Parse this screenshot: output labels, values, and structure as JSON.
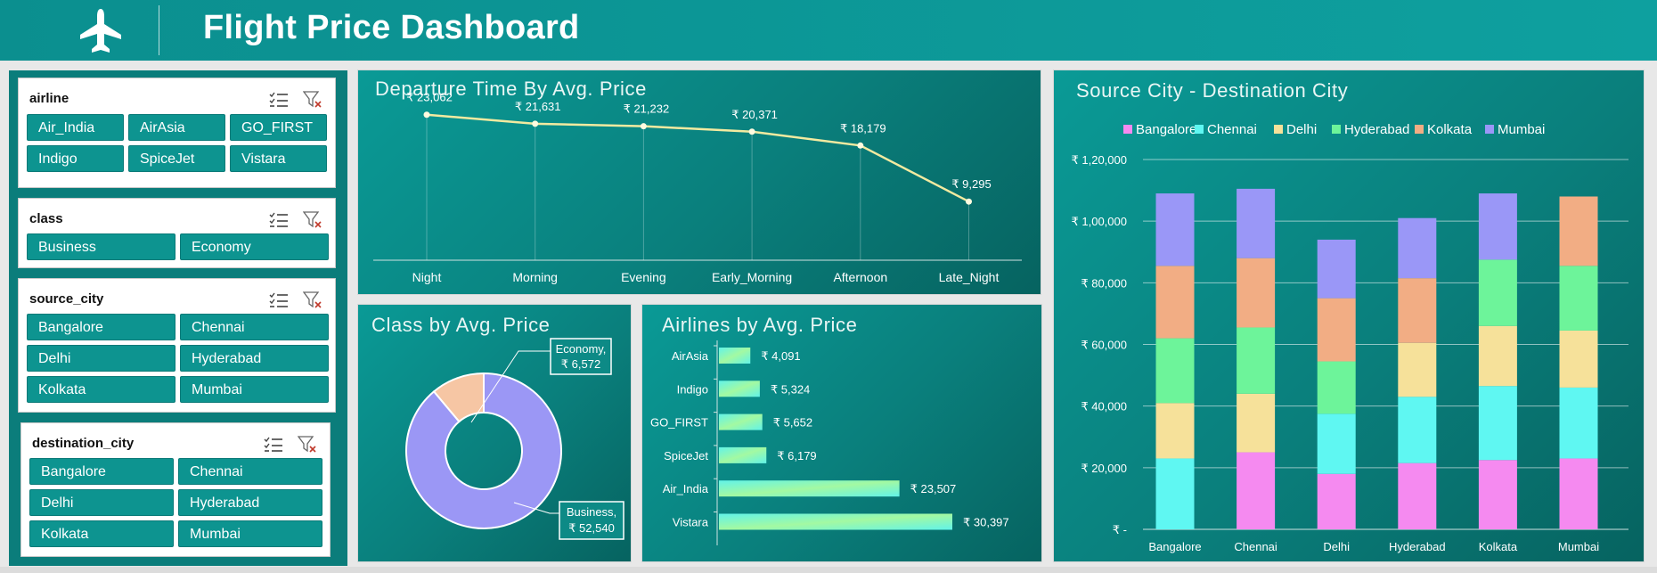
{
  "header": {
    "title": "Flight Price Dashboard",
    "icon": "airplane-icon"
  },
  "slicers": [
    {
      "key": "airline",
      "title": "airline",
      "items": [
        "Air_India",
        "AirAsia",
        "GO_FIRST",
        "Indigo",
        "SpiceJet",
        "Vistara"
      ]
    },
    {
      "key": "class",
      "title": "class",
      "items": [
        "Business",
        "Economy"
      ]
    },
    {
      "key": "source_city",
      "title": "source_city",
      "items": [
        "Bangalore",
        "Chennai",
        "Delhi",
        "Hyderabad",
        "Kolkata",
        "Mumbai"
      ]
    },
    {
      "key": "destination_city",
      "title": "destination_city",
      "items": [
        "Bangalore",
        "Chennai",
        "Delhi",
        "Hyderabad",
        "Kolkata",
        "Mumbai"
      ]
    }
  ],
  "slicer_icons": [
    "multi-select-icon",
    "clear-filter-icon"
  ],
  "panels": {
    "departure": {
      "title": "Departure Time By Avg. Price"
    },
    "class": {
      "title": "Class by Avg. Price"
    },
    "airlines": {
      "title": "Airlines by Avg. Price"
    },
    "city": {
      "title": "Source City - Destination City"
    }
  },
  "colors": {
    "header": "#0b8f8f",
    "line": "#f2eaa0",
    "economy": "#f6c6a4",
    "business": "#9b97f5",
    "bar_start": "#62f3e8",
    "bar_end": "#a3f9a2"
  },
  "chart_data": [
    {
      "id": "departure",
      "type": "line",
      "title": "Departure Time By Avg. Price",
      "categories": [
        "Night",
        "Morning",
        "Evening",
        "Early_Morning",
        "Afternoon",
        "Late_Night"
      ],
      "values": [
        23062,
        21631,
        21232,
        20371,
        18179,
        9295
      ],
      "labels": [
        "₹ 23,062",
        "₹ 21,631",
        "₹ 21,232",
        "₹ 20,371",
        "₹ 18,179",
        "₹ 9,295"
      ],
      "ylim": [
        0,
        25000
      ]
    },
    {
      "id": "class",
      "type": "pie",
      "title": "Class by Avg. Price",
      "slices": [
        {
          "name": "Economy",
          "value": 6572,
          "label_name": "Economy,",
          "label_value": "₹ 6,572"
        },
        {
          "name": "Business",
          "value": 52540,
          "label_name": "Business,",
          "label_value": "₹ 52,540"
        }
      ]
    },
    {
      "id": "airlines",
      "type": "bar",
      "title": "Airlines by Avg. Price",
      "categories": [
        "AirAsia",
        "Indigo",
        "GO_FIRST",
        "SpiceJet",
        "Air_India",
        "Vistara"
      ],
      "values": [
        4091,
        5324,
        5652,
        6179,
        23507,
        30397
      ],
      "labels": [
        "₹ 4,091",
        "₹ 5,324",
        "₹ 5,652",
        "₹ 6,179",
        "₹ 23,507",
        "₹ 30,397"
      ],
      "xlim": [
        0,
        32000
      ]
    },
    {
      "id": "city",
      "type": "bar",
      "title": "Source City - Destination City",
      "categories": [
        "Bangalore",
        "Chennai",
        "Delhi",
        "Hyderabad",
        "Kolkata",
        "Mumbai"
      ],
      "ylim": [
        0,
        120000
      ],
      "yticks": [
        "₹ -",
        "₹ 20,000",
        "₹ 40,000",
        "₹ 60,000",
        "₹ 80,000",
        "₹ 1,00,000",
        "₹ 1,20,000"
      ],
      "legend_position": "top",
      "series": [
        {
          "name": "Bangalore",
          "color": "#f58af0",
          "values": [
            0,
            25000,
            18000,
            21500,
            22500,
            23000
          ]
        },
        {
          "name": "Chennai",
          "color": "#5ff7f2",
          "values": [
            23000,
            0,
            19500,
            21500,
            24000,
            23000
          ]
        },
        {
          "name": "Delhi",
          "color": "#f6e19a",
          "values": [
            18000,
            19000,
            0,
            17500,
            19500,
            18500
          ]
        },
        {
          "name": "Hyderabad",
          "color": "#6df49a",
          "values": [
            21000,
            21500,
            17000,
            0,
            21500,
            21000
          ]
        },
        {
          "name": "Kolkata",
          "color": "#f2ad84",
          "values": [
            23500,
            22500,
            20500,
            21000,
            0,
            22500
          ]
        },
        {
          "name": "Mumbai",
          "color": "#9a97f7",
          "values": [
            23500,
            22500,
            19000,
            19500,
            21500,
            0
          ]
        }
      ]
    }
  ]
}
